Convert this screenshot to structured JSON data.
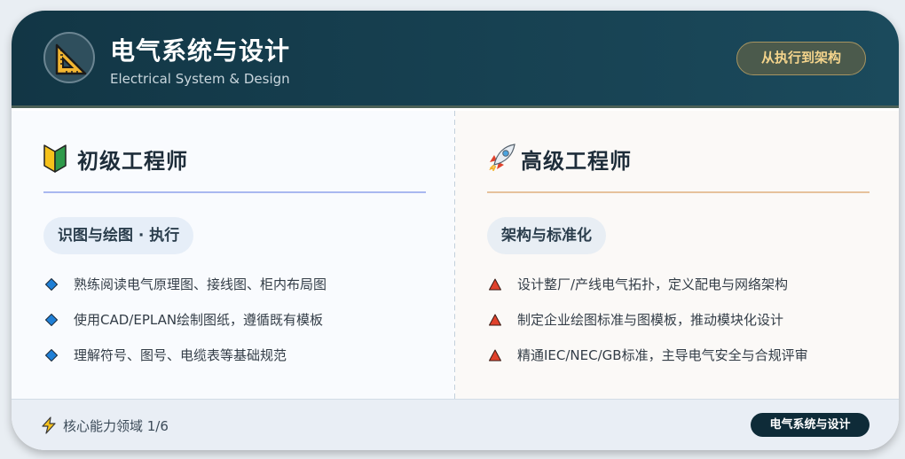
{
  "header": {
    "title": "电气系统与设计",
    "subtitle": "Electrical System & Design",
    "badge": "从执行到架构",
    "logo_icon": "triangle-ruler-icon"
  },
  "junior": {
    "icon": "beginner-badge-icon",
    "title": "初级工程师",
    "tag": "识图与绘图 · 执行",
    "accent": "#a9b8f0",
    "bullet_color": "#1f7fd6",
    "items": [
      "熟练阅读电气原理图、接线图、柜内布局图",
      "使用CAD/EPLAN绘制图纸，遵循既有模板",
      "理解符号、图号、电缆表等基础规范"
    ]
  },
  "senior": {
    "icon": "rocket-icon",
    "title": "高级工程师",
    "tag": "架构与标准化",
    "accent": "#e6c29c",
    "bullet_color": "#e0422c",
    "items": [
      "设计整厂/产线电气拓扑，定义配电与网络架构",
      "制定企业绘图标准与图模板，推动模块化设计",
      "精通IEC/NEC/GB标准，主导电气安全与合规评审"
    ]
  },
  "footer": {
    "icon": "lightning-bolt-icon",
    "progress": "核心能力领域 1/6",
    "badge": "电气系统与设计"
  }
}
